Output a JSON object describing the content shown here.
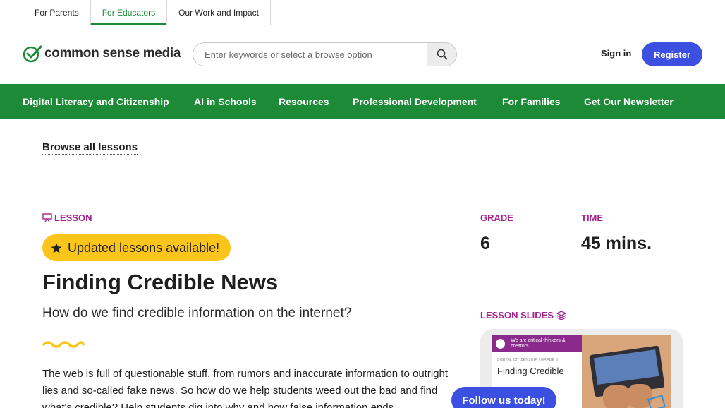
{
  "top_tabs": [
    {
      "label": "For Parents",
      "active": false
    },
    {
      "label": "For Educators",
      "active": true
    },
    {
      "label": "Our Work and Impact",
      "active": false
    }
  ],
  "header": {
    "logo_text": "common sense media",
    "search_placeholder": "Enter keywords or select a browse option",
    "sign_in": "Sign in",
    "register": "Register"
  },
  "nav": {
    "items": [
      "Digital Literacy and Citizenship",
      "AI in Schools",
      "Resources",
      "Professional Development",
      "For Families",
      "Get Our Newsletter"
    ]
  },
  "page": {
    "browse_link": "Browse all lessons",
    "lesson_tag": "LESSON",
    "badge": "Updated lessons available!",
    "title": "Finding Credible News",
    "subtitle": "How do we find credible information on the internet?",
    "description": "The web is full of questionable stuff, from rumors and inaccurate information to outright lies and so-called fake news. So how do we help students weed out the bad and find what's credible? Help students dig into why and how false information ends",
    "grade_label": "GRADE",
    "grade_value": "6",
    "time_label": "TIME",
    "time_value": "45 mins.",
    "slides_label": "LESSON SLIDES",
    "slide_preview": {
      "band_text": "We are critical thinkers & creators.",
      "small_text": "DIGITAL CITIZENSHIP | GRADE 6",
      "big_text": "Finding Credible"
    },
    "follow_button": "Follow us today!"
  },
  "colors": {
    "brand_green": "#1d8a37",
    "accent_purple": "#a3248f",
    "button_blue": "#3b4fe0",
    "badge_yellow": "#fbc51b"
  },
  "icons": [
    "check-logo-icon",
    "search-icon",
    "presentation-icon",
    "star-icon",
    "squiggle-divider",
    "layers-icon"
  ]
}
